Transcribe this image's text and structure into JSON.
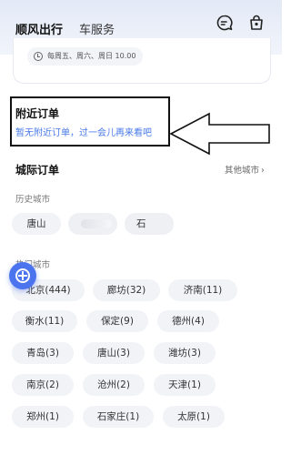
{
  "header": {
    "tabs": [
      {
        "label": "顺风出行",
        "active": true
      },
      {
        "label": "车服务",
        "active": false
      }
    ],
    "icons": [
      "message-icon",
      "bag-icon"
    ]
  },
  "schedule": {
    "days_text": "每周五、周六、周日 10.00"
  },
  "nearby": {
    "title": "附近订单",
    "empty_text": "暂无附近订单，过一会儿再来看吧"
  },
  "intercity": {
    "title": "城际订单",
    "other_city_label": "其他城市",
    "history_label": "历史城市",
    "history_cities": [
      "唐山",
      "",
      "石"
    ],
    "hot_label": "热门城市",
    "hot_cities": [
      "北京(444)",
      "廊坊(32)",
      "济南(11)",
      "衡水(11)",
      "保定(9)",
      "德州(4)",
      "青岛(3)",
      "唐山(3)",
      "潍坊(3)",
      "南京(2)",
      "沧州(2)",
      "天津(1)",
      "郑州(1)",
      "石家庄(1)",
      "太原(1)"
    ]
  },
  "colors": {
    "accent": "#4b74ee",
    "empty_text": "#4a7ae8",
    "chip_bg": "#f1f3f7"
  }
}
